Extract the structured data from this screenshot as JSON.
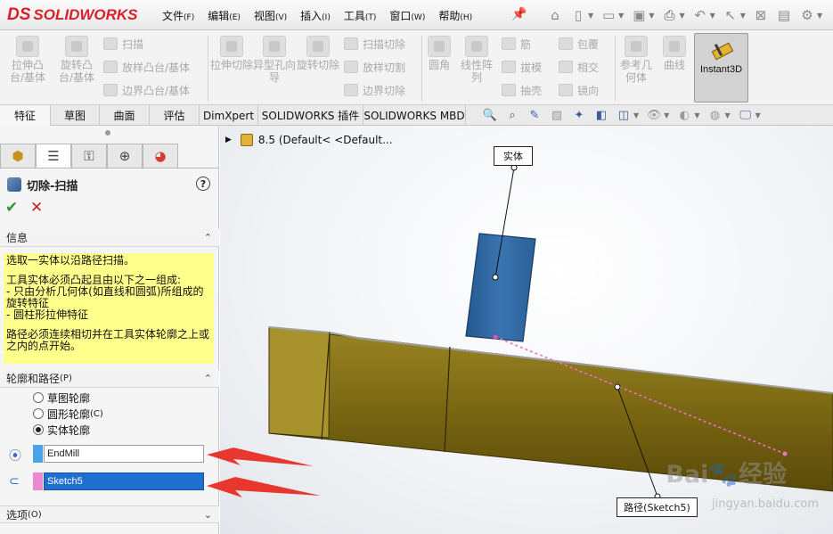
{
  "app": {
    "logo_text": "SOLIDWORKS",
    "logo_mark": "DS"
  },
  "menu": [
    {
      "label": "文件",
      "key": "(F)"
    },
    {
      "label": "编辑",
      "key": "(E)"
    },
    {
      "label": "视图",
      "key": "(V)"
    },
    {
      "label": "插入",
      "key": "(I)"
    },
    {
      "label": "工具",
      "key": "(T)"
    },
    {
      "label": "窗口",
      "key": "(W)"
    },
    {
      "label": "帮助",
      "key": "(H)"
    }
  ],
  "commands": {
    "extrude_boss": "拉伸凸台/基体",
    "revolve_boss": "旋转凸台/基体",
    "sweep": "扫描",
    "loft_boss": "放样凸台/基体",
    "boundary_boss": "边界凸台/基体",
    "extrude_cut": "拉伸切除",
    "hole_wizard": "异型孔向导",
    "revolve_cut": "旋转切除",
    "sweep_cut": "扫描切除",
    "loft_cut": "放样切割",
    "boundary_cut": "边界切除",
    "fillet": "圆角",
    "linear_pattern": "线性阵列",
    "rib": "筋",
    "draft": "拔模",
    "shell": "抽壳",
    "wrap": "包覆",
    "intersect": "相交",
    "mirror": "镜向",
    "ref_geometry": "参考几何体",
    "curves": "曲线",
    "instant3d": "Instant3D"
  },
  "tabs": [
    "特征",
    "草图",
    "曲面",
    "评估",
    "DimXpert",
    "SOLIDWORKS 插件",
    "SOLIDWORKS MBD"
  ],
  "panel": {
    "feature_title": "切除-扫描",
    "help": "?",
    "ok": "✔",
    "cancel": "✕",
    "info_header": "信息",
    "info_lines": [
      "选取一实体以沿路径扫描。",
      "工具实体必须凸起且由以下之一组成:\n - 只由分析几何体(如直线和圆弧)所组成的旋转特征\n - 圆柱形拉伸特征",
      "路径必须连续相切并在工具实体轮廓之上或之内的点开始。"
    ],
    "profile_header": "轮廓和路径",
    "profile_header_key": "(P)",
    "radios": [
      {
        "label": "草图轮廓",
        "selected": false
      },
      {
        "label": "圆形轮廓",
        "key": "(C)",
        "selected": false
      },
      {
        "label": "实体轮廓",
        "selected": true
      }
    ],
    "tool_body": {
      "value": "EndMill",
      "color": "#4aa3e8"
    },
    "path": {
      "value": "Sketch5",
      "color": "#e98ad0"
    },
    "options_header": "选项",
    "options_key": "(O)"
  },
  "viewport": {
    "tree_label": "8.5  (Default< <Default...",
    "callout_body": "实体",
    "callout_path": "路径(Sketch5)",
    "watermark": "Bai",
    "watermark_tail": "经验",
    "watermark_url": "jingyan.baidu.com",
    "part_color": "#8f7a1c",
    "tool_color": "#2f68a6",
    "path_color": "#f06ec8"
  }
}
